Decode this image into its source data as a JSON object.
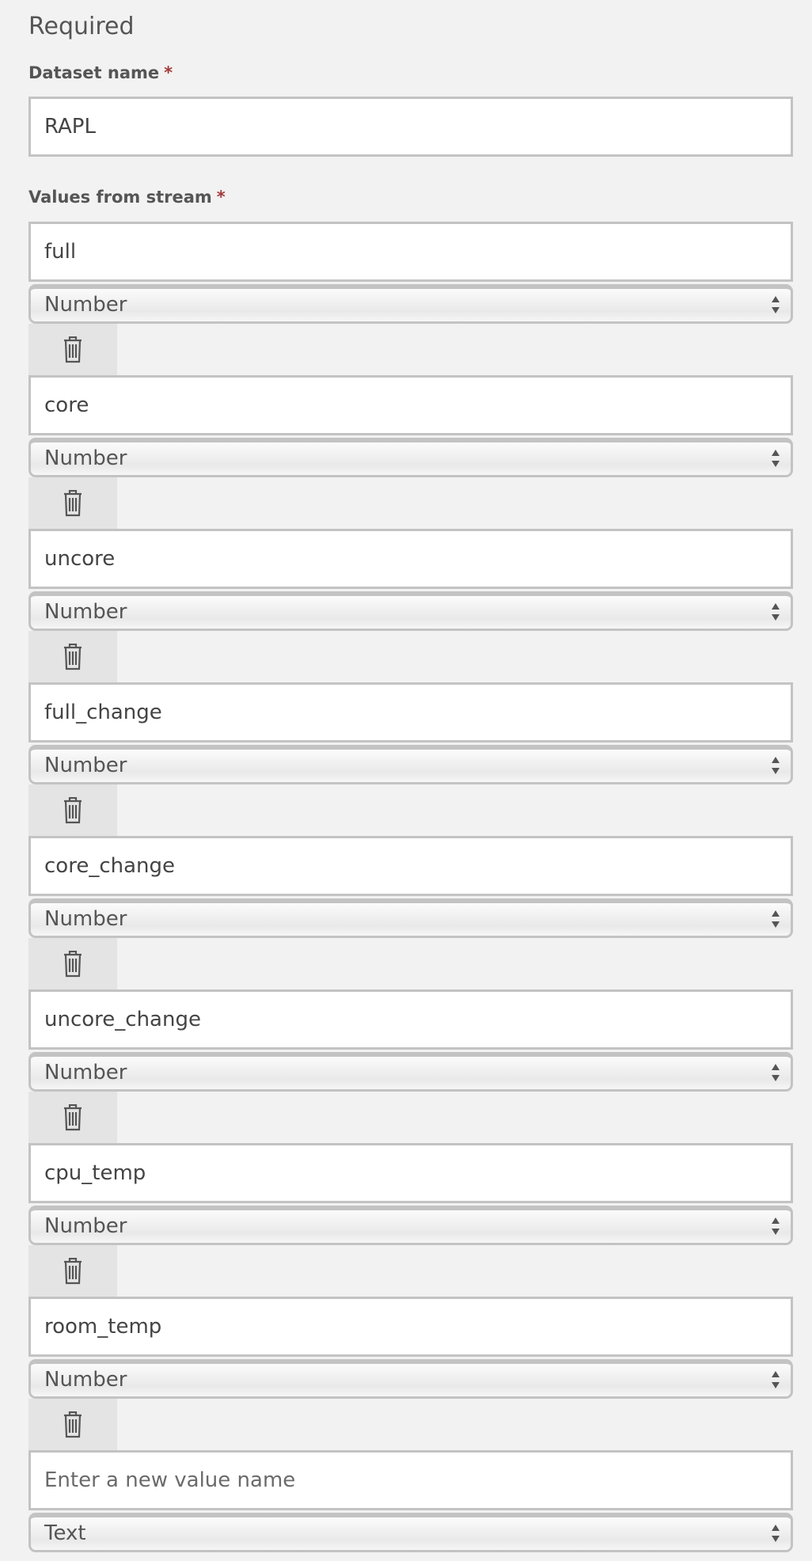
{
  "section": {
    "title": "Required"
  },
  "dataset": {
    "label": "Dataset name",
    "required_mark": "*",
    "value": "RAPL"
  },
  "values_from_stream": {
    "label": "Values from stream",
    "required_mark": "*",
    "items": [
      {
        "name": "full",
        "type": "Number"
      },
      {
        "name": "core",
        "type": "Number"
      },
      {
        "name": "uncore",
        "type": "Number"
      },
      {
        "name": "full_change",
        "type": "Number"
      },
      {
        "name": "core_change",
        "type": "Number"
      },
      {
        "name": "uncore_change",
        "type": "Number"
      },
      {
        "name": "cpu_temp",
        "type": "Number"
      },
      {
        "name": "room_temp",
        "type": "Number"
      }
    ],
    "new_value": {
      "placeholder": "Enter a new value name",
      "type": "Text"
    }
  },
  "icons": {
    "delete": "trash-icon",
    "select_arrows": "chevron-updown-icon"
  },
  "colors": {
    "background": "#f2f2f2",
    "input_border": "#c3c3c3",
    "delete_button_bg": "#e4e4e4",
    "required_mark": "#a33a3a",
    "text": "#444444"
  }
}
